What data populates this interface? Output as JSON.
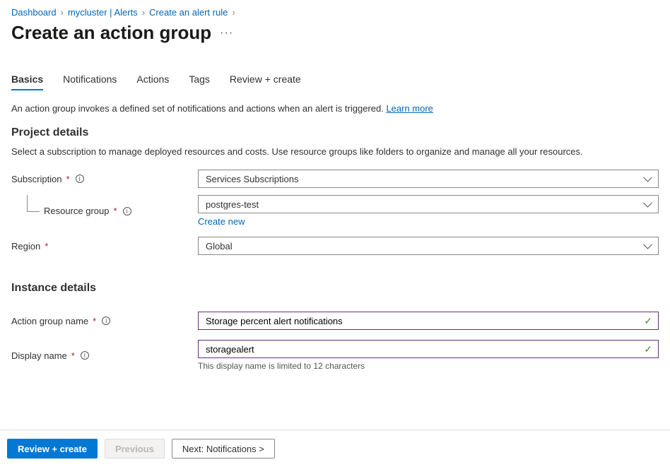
{
  "breadcrumb": {
    "items": [
      "Dashboard",
      "mycluster | Alerts",
      "Create an alert rule"
    ]
  },
  "title": "Create an action group",
  "tabs": [
    "Basics",
    "Notifications",
    "Actions",
    "Tags",
    "Review + create"
  ],
  "intro": {
    "text": "An action group invokes a defined set of notifications and actions when an alert is triggered. ",
    "link": "Learn more"
  },
  "sections": {
    "project": {
      "heading": "Project details",
      "sub": "Select a subscription to manage deployed resources and costs. Use resource groups like folders to organize and manage all your resources.",
      "subscription": {
        "label": "Subscription",
        "value": "Services Subscriptions"
      },
      "resourceGroup": {
        "label": "Resource group",
        "value": "postgres-test",
        "createNew": "Create new"
      },
      "region": {
        "label": "Region",
        "value": "Global"
      }
    },
    "instance": {
      "heading": "Instance details",
      "actionGroupName": {
        "label": "Action group name",
        "value": "Storage percent alert notifications"
      },
      "displayName": {
        "label": "Display name",
        "value": "storagealert",
        "hint": "This display name is limited to 12 characters"
      }
    }
  },
  "footer": {
    "review": "Review + create",
    "previous": "Previous",
    "next": "Next: Notifications >"
  }
}
